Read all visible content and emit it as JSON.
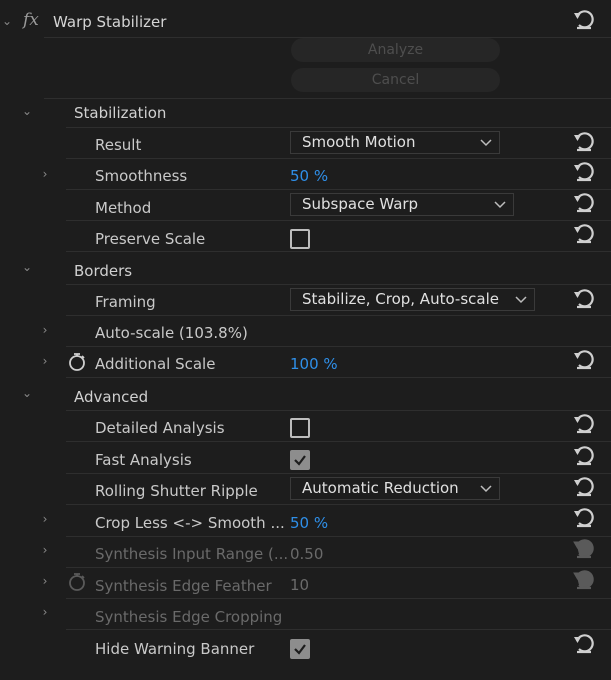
{
  "effect": {
    "fx_label": "fx",
    "title": "Warp Stabilizer",
    "analyze_label": "Analyze",
    "cancel_label": "Cancel"
  },
  "stabilization": {
    "header": "Stabilization",
    "result": {
      "label": "Result",
      "value": "Smooth Motion"
    },
    "smoothness": {
      "label": "Smoothness",
      "value": "50",
      "unit": "%"
    },
    "method": {
      "label": "Method",
      "value": "Subspace Warp"
    },
    "preserve_scale": {
      "label": "Preserve Scale",
      "checked": false
    }
  },
  "borders": {
    "header": "Borders",
    "framing": {
      "label": "Framing",
      "value": "Stabilize, Crop, Auto-scale"
    },
    "auto_scale": {
      "label": "Auto-scale (103.8%)"
    },
    "additional_scale": {
      "label": "Additional Scale",
      "value": "100",
      "unit": "%"
    }
  },
  "advanced": {
    "header": "Advanced",
    "detailed_analysis": {
      "label": "Detailed Analysis",
      "checked": false
    },
    "fast_analysis": {
      "label": "Fast Analysis",
      "checked": true
    },
    "rolling_shutter": {
      "label": "Rolling Shutter Ripple",
      "value": "Automatic Reduction"
    },
    "crop_less": {
      "label": "Crop Less <-> Smooth ...",
      "value": "50",
      "unit": "%"
    },
    "synthesis_input_range": {
      "label": "Synthesis Input Range (...",
      "value": "0.50"
    },
    "synthesis_edge_feather": {
      "label": "Synthesis Edge Feather",
      "value": "10"
    },
    "synthesis_edge_cropping": {
      "label": "Synthesis Edge Cropping"
    },
    "hide_warning_banner": {
      "label": "Hide Warning Banner",
      "checked": true
    }
  },
  "colors": {
    "value_blue": "#2f8fe8",
    "background": "#1d1d1d",
    "text": "#cfcfcf",
    "disabled": "#6a6a6a"
  },
  "icons": [
    "chevron-down-icon",
    "chevron-right-icon",
    "reset-icon",
    "stopwatch-icon",
    "checkmark-icon",
    "dropdown-arrow-icon"
  ]
}
